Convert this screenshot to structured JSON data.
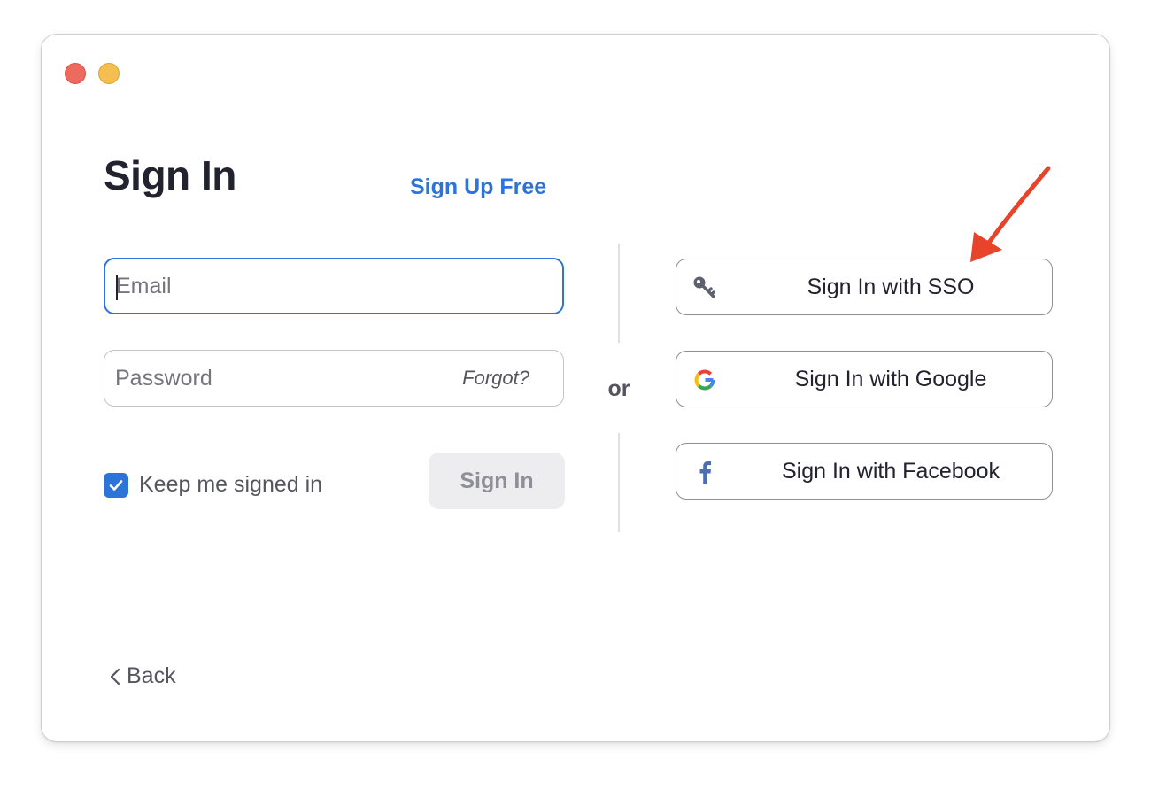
{
  "window": {
    "traffic_lights": [
      {
        "name": "close",
        "color": "#ec6a5e"
      },
      {
        "name": "minimize",
        "color": "#f4bf4f"
      }
    ]
  },
  "header": {
    "title": "Sign In",
    "signup_link": "Sign Up Free"
  },
  "form": {
    "email_placeholder": "Email",
    "email_value": "",
    "password_placeholder": "Password",
    "password_value": "",
    "forgot_label": "Forgot?",
    "keep_signed_in_label": "Keep me signed in",
    "keep_signed_in_checked": true,
    "signin_button_label": "Sign In"
  },
  "divider": {
    "or_label": "or"
  },
  "social": [
    {
      "id": "sso",
      "label": "Sign In with SSO",
      "icon": "key-icon"
    },
    {
      "id": "google",
      "label": "Sign In with Google",
      "icon": "google-icon"
    },
    {
      "id": "facebook",
      "label": "Sign In with Facebook",
      "icon": "facebook-icon"
    }
  ],
  "footer": {
    "back_label": "Back"
  },
  "colors": {
    "accent": "#2d74d9",
    "annotation_arrow": "#e8432b"
  }
}
